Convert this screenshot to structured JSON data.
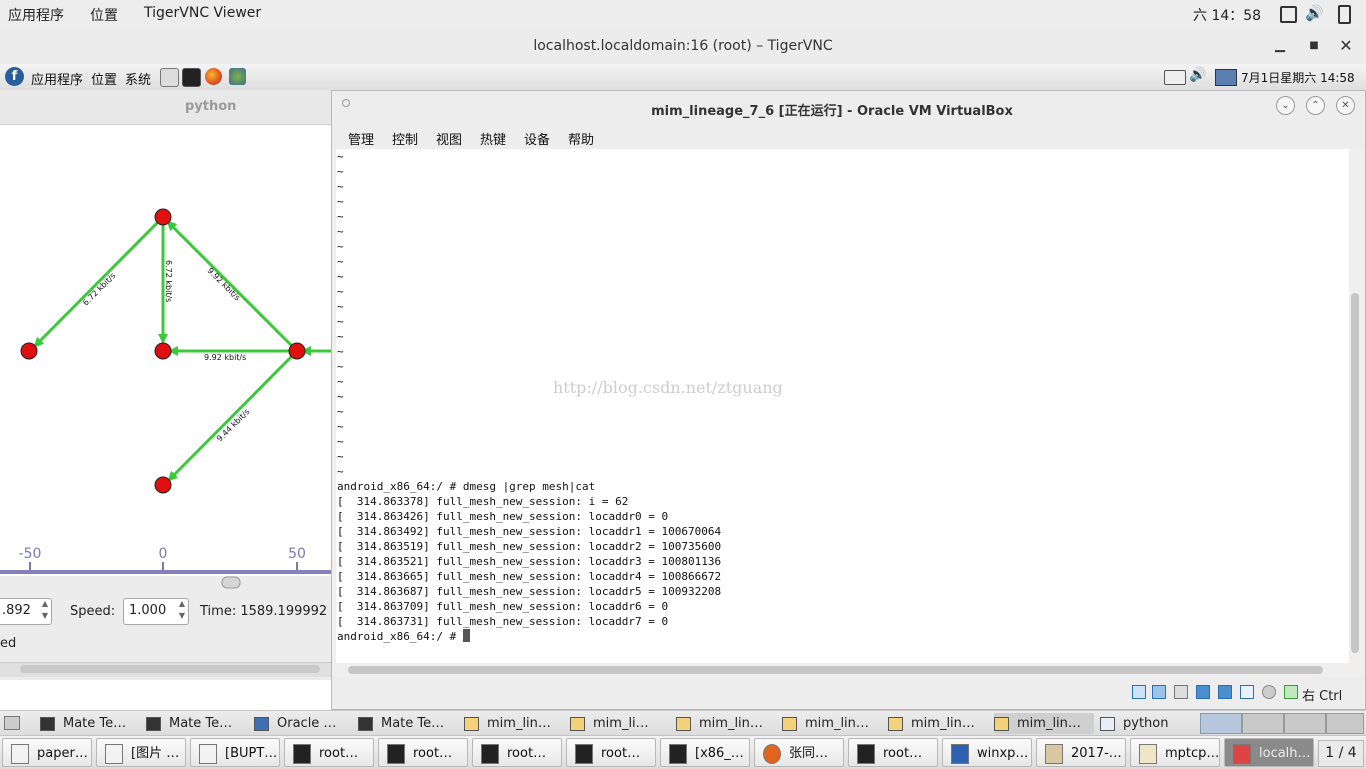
{
  "topbar": {
    "apps": "应用程序",
    "places": "位置",
    "app_name": "TigerVNC Viewer",
    "clock": "六 14：58"
  },
  "vnc": {
    "title": "localhost.localdomain:16 (root) – TigerVNC"
  },
  "remote_panel": {
    "apps": "应用程序",
    "places": "位置",
    "system": "系统",
    "datetime": "7月1日星期六 14:58"
  },
  "python_window": {
    "title": "python",
    "edge_labels": [
      "6.72 kbit/s",
      "6.72 kbit/s",
      "9.92 kbit/s",
      "9.92 kbit/s",
      "9.44 kbit/s"
    ],
    "axis_ticks": [
      "-50",
      "0",
      "50"
    ],
    "time_value": ".892",
    "speed_label": "Speed:",
    "speed_value": "1.000",
    "time_label": "Time: 1589.199992",
    "status_fragment": "ed"
  },
  "vbox": {
    "title": "mim_lineage_7_6 [正在运行] - Oracle VM VirtualBox",
    "menu": [
      "管理",
      "控制",
      "视图",
      "热键",
      "设备",
      "帮助"
    ],
    "watermark": "http://blog.csdn.net/ztguang",
    "host_key": "右 Ctrl",
    "terminal_lines": [
      "~",
      "~",
      "~",
      "~",
      "~",
      "~",
      "~",
      "~",
      "~",
      "~",
      "~",
      "~",
      "~",
      "~",
      "~",
      "~",
      "~",
      "~",
      "~",
      "~",
      "~",
      "~",
      "android_x86_64:/ # dmesg |grep mesh|cat",
      "[  314.863378] full_mesh_new_session: i = 62",
      "[  314.863426] full_mesh_new_session: locaddr0 = 0",
      "[  314.863492] full_mesh_new_session: locaddr1 = 100670064",
      "[  314.863519] full_mesh_new_session: locaddr2 = 100735600",
      "[  314.863521] full_mesh_new_session: locaddr3 = 100801136",
      "[  314.863665] full_mesh_new_session: locaddr4 = 100866672",
      "[  314.863687] full_mesh_new_session: locaddr5 = 100932208",
      "[  314.863709] full_mesh_new_session: locaddr6 = 0",
      "[  314.863731] full_mesh_new_session: locaddr7 = 0",
      "android_x86_64:/ # "
    ]
  },
  "taskbar_windows": [
    "Mate Te…",
    "Mate Te…",
    "Oracle …",
    "Mate Te…",
    "mim_lin…",
    "mim_li…",
    "mim_lin…",
    "mim_lin…",
    "mim_lin…",
    "mim_lin…",
    "python"
  ],
  "taskbar_host": [
    "paper…",
    "[图片 …",
    "[BUPT…",
    "root…",
    "root…",
    "root…",
    "root…",
    "[x86_…",
    "张同…",
    "root…",
    "winxp…",
    "2017-…",
    "mptcp…",
    "localh…"
  ],
  "workspace": "1 / 4"
}
